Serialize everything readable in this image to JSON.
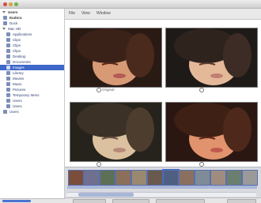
{
  "window": {
    "title": ""
  },
  "sidebar": {
    "items": [
      {
        "label": "Users"
      },
      {
        "label": "Eudora"
      },
      {
        "label": "Dock"
      },
      {
        "label": "Mac HD"
      },
      {
        "label": "Applications"
      },
      {
        "label": "Clips"
      },
      {
        "label": "Clips"
      },
      {
        "label": "Clips"
      },
      {
        "label": "Desktop"
      },
      {
        "label": "Documents"
      },
      {
        "label": "Images"
      },
      {
        "label": "Library"
      },
      {
        "label": "Movies"
      },
      {
        "label": "Music"
      },
      {
        "label": "Pictures"
      },
      {
        "label": "Temporary Items"
      },
      {
        "label": "Users"
      },
      {
        "label": "Users"
      },
      {
        "label": "Users"
      }
    ]
  },
  "menu": {
    "items": [
      "File",
      "View",
      "Window"
    ]
  },
  "viewer": {
    "captions": [
      "Original",
      "",
      "",
      ""
    ]
  },
  "filmstrip": {
    "thumbs": [
      "",
      "",
      "",
      "",
      "",
      "",
      "",
      "",
      "",
      "",
      "",
      ""
    ]
  },
  "colors": {
    "accent": "#3d67c9",
    "photo_bg": "#1b1b1b"
  }
}
